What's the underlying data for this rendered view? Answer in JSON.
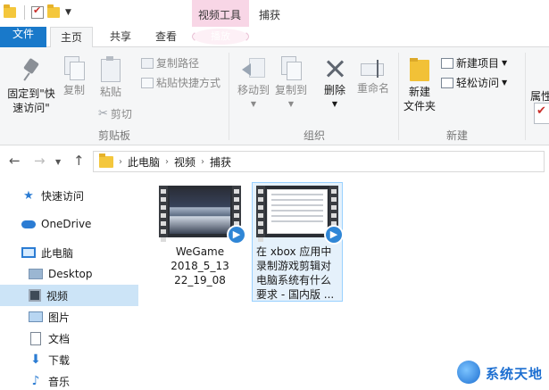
{
  "title_bar": {
    "context_group": "视频工具",
    "window_title": "捕获"
  },
  "tabs": {
    "file": "文件",
    "home": "主页",
    "share": "共享",
    "view": "查看",
    "play": "播放"
  },
  "ribbon": {
    "clipboard": {
      "pin": "固定到\"快\n速访问\"",
      "copy": "复制",
      "paste": "粘贴",
      "copy_path": "复制路径",
      "paste_shortcut": "粘贴快捷方式",
      "cut": "剪切",
      "label": "剪贴板"
    },
    "organize": {
      "move_to": "移动到",
      "copy_to": "复制到",
      "delete": "删除",
      "rename": "重命名",
      "label": "组织"
    },
    "new": {
      "new_folder": "新建\n文件夹",
      "new_item": "新建项目",
      "easy_access": "轻松访问",
      "label": "新建"
    },
    "open": {
      "properties": "属性"
    }
  },
  "address": {
    "crumbs": [
      "此电脑",
      "视频",
      "捕获"
    ]
  },
  "sidebar": {
    "items": [
      "快速访问",
      "OneDrive",
      "此电脑",
      "Desktop",
      "视频",
      "图片",
      "文档",
      "下载",
      "音乐"
    ]
  },
  "files": [
    {
      "name": "WeGame\n2018_5_13\n22_19_08"
    },
    {
      "name": "在 xbox 应用中\n录制游戏剪辑对\n电脑系统有什么\n要求 - 国内版 ..."
    }
  ],
  "watermark": {
    "text": "系统天地"
  }
}
